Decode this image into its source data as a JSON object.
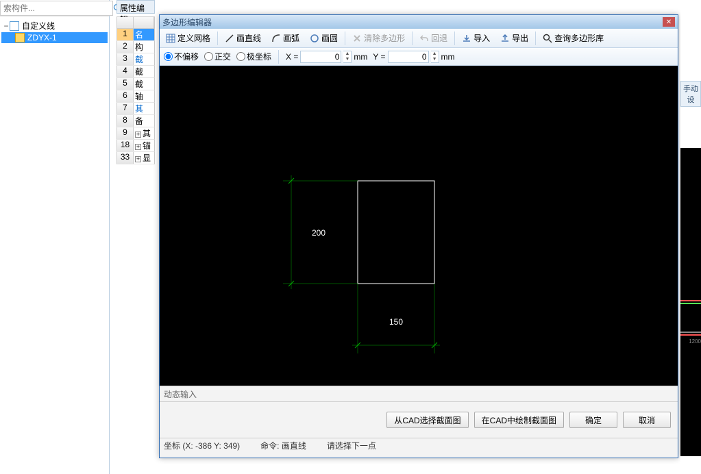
{
  "search": {
    "placeholder": "索构件..."
  },
  "tree": {
    "root": "自定义线",
    "child": "ZDYX-1"
  },
  "propPanel": {
    "title": "属性编辑",
    "rows": [
      {
        "num": "1",
        "label": "名",
        "selected": true
      },
      {
        "num": "2",
        "label": "构"
      },
      {
        "num": "3",
        "label": "截",
        "link": true
      },
      {
        "num": "4",
        "label": "截"
      },
      {
        "num": "5",
        "label": "截"
      },
      {
        "num": "6",
        "label": "轴"
      },
      {
        "num": "7",
        "label": "其",
        "link": true
      },
      {
        "num": "8",
        "label": "备"
      },
      {
        "num": "9",
        "label": "其",
        "expand": true
      },
      {
        "num": "18",
        "label": "锚",
        "expand": true
      },
      {
        "num": "33",
        "label": "显",
        "expand": true
      }
    ]
  },
  "dialog": {
    "title": "多边形编辑器",
    "toolbar": {
      "grid": "定义网格",
      "line": "画直线",
      "arc": "画弧",
      "circle": "画圆",
      "clear": "清除多边形",
      "undo": "回退",
      "import": "导入",
      "export": "导出",
      "query": "查询多边形库"
    },
    "options": {
      "noOffset": "不偏移",
      "ortho": "正交",
      "polar": "极坐标",
      "xLabel": "X =",
      "xValue": "0",
      "yLabel": "Y =",
      "yValue": "0",
      "unit": "mm"
    },
    "drawing": {
      "dim1": "200",
      "dim2": "150"
    },
    "dynInput": "动态输入",
    "buttons": {
      "selectCad": "从CAD选择截面图",
      "drawCad": "在CAD中绘制截面图",
      "ok": "确定",
      "cancel": "取消"
    },
    "status": {
      "coord": "坐标 (X: -386 Y: 349)",
      "cmdLabel": "命令:",
      "cmd": "画直线",
      "prompt": "请选择下一点"
    }
  },
  "rightEdge": {
    "label": "手动设"
  }
}
